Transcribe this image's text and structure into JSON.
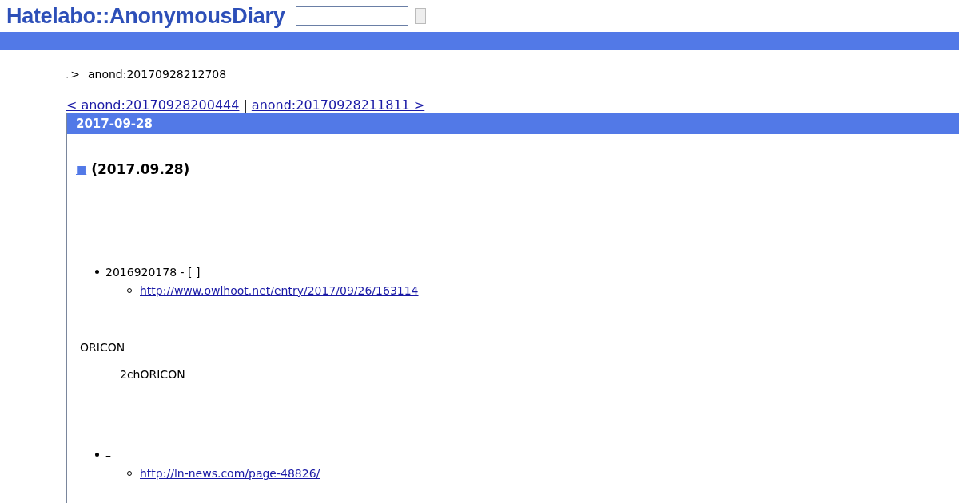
{
  "header": {
    "logo": "Hatelabo::AnonymousDiary"
  },
  "breadcrumb": {
    "home": ".",
    "separator": ">",
    "current": "anond:20170928212708"
  },
  "pager": {
    "prev": "< anond:20170928200444",
    "separator": "|",
    "next": "anond:20170928211811 >"
  },
  "section": {
    "date": "2017-09-28",
    "mark": "■",
    "title": "(2017.09.28)",
    "body": [
      {
        "kind": "list",
        "items": [
          {
            "text": "2016920178 - [  ]",
            "children": [
              "http://www.owlhoot.net/entry/2017/09/26/163114"
            ]
          }
        ]
      },
      {
        "kind": "paragraph",
        "text": "ORICON"
      },
      {
        "kind": "quote",
        "text": "2chORICON"
      },
      {
        "kind": "list",
        "items": [
          {
            "text": "–",
            "children": [
              "http://ln-news.com/page-48826/"
            ]
          }
        ]
      }
    ]
  }
}
